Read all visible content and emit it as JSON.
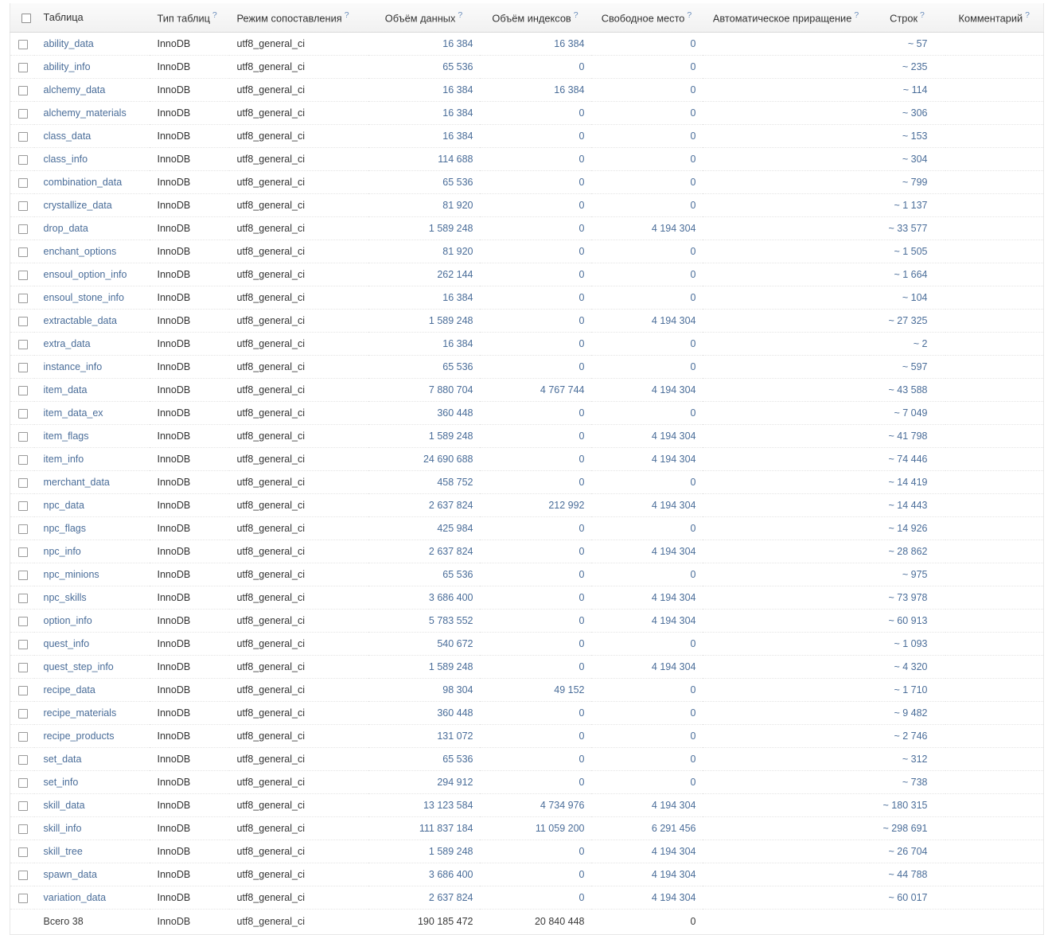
{
  "table": {
    "columns": [
      {
        "key": "check",
        "label": "",
        "help": false
      },
      {
        "key": "name",
        "label": "Таблица",
        "help": false
      },
      {
        "key": "type",
        "label": "Тип таблиц",
        "help": true
      },
      {
        "key": "coll",
        "label": "Режим сопоставления",
        "help": true
      },
      {
        "key": "data",
        "label": "Объём данных",
        "help": true
      },
      {
        "key": "index",
        "label": "Объём индексов",
        "help": true
      },
      {
        "key": "free",
        "label": "Свободное место",
        "help": true
      },
      {
        "key": "auto",
        "label": "Автоматическое приращение",
        "help": true
      },
      {
        "key": "rows",
        "label": "Строк",
        "help": true
      },
      {
        "key": "comment",
        "label": "Комментарий",
        "help": true
      }
    ],
    "help_glyph": "?",
    "rows": [
      {
        "name": "ability_data",
        "type": "InnoDB",
        "coll": "utf8_general_ci",
        "data": "16 384",
        "index": "16 384",
        "free": "0",
        "auto": "",
        "rows": "~ 57",
        "comment": ""
      },
      {
        "name": "ability_info",
        "type": "InnoDB",
        "coll": "utf8_general_ci",
        "data": "65 536",
        "index": "0",
        "free": "0",
        "auto": "",
        "rows": "~ 235",
        "comment": ""
      },
      {
        "name": "alchemy_data",
        "type": "InnoDB",
        "coll": "utf8_general_ci",
        "data": "16 384",
        "index": "16 384",
        "free": "0",
        "auto": "",
        "rows": "~ 114",
        "comment": ""
      },
      {
        "name": "alchemy_materials",
        "type": "InnoDB",
        "coll": "utf8_general_ci",
        "data": "16 384",
        "index": "0",
        "free": "0",
        "auto": "",
        "rows": "~ 306",
        "comment": ""
      },
      {
        "name": "class_data",
        "type": "InnoDB",
        "coll": "utf8_general_ci",
        "data": "16 384",
        "index": "0",
        "free": "0",
        "auto": "",
        "rows": "~ 153",
        "comment": ""
      },
      {
        "name": "class_info",
        "type": "InnoDB",
        "coll": "utf8_general_ci",
        "data": "114 688",
        "index": "0",
        "free": "0",
        "auto": "",
        "rows": "~ 304",
        "comment": ""
      },
      {
        "name": "combination_data",
        "type": "InnoDB",
        "coll": "utf8_general_ci",
        "data": "65 536",
        "index": "0",
        "free": "0",
        "auto": "",
        "rows": "~ 799",
        "comment": ""
      },
      {
        "name": "crystallize_data",
        "type": "InnoDB",
        "coll": "utf8_general_ci",
        "data": "81 920",
        "index": "0",
        "free": "0",
        "auto": "",
        "rows": "~ 1 137",
        "comment": ""
      },
      {
        "name": "drop_data",
        "type": "InnoDB",
        "coll": "utf8_general_ci",
        "data": "1 589 248",
        "index": "0",
        "free": "4 194 304",
        "auto": "",
        "rows": "~ 33 577",
        "comment": ""
      },
      {
        "name": "enchant_options",
        "type": "InnoDB",
        "coll": "utf8_general_ci",
        "data": "81 920",
        "index": "0",
        "free": "0",
        "auto": "",
        "rows": "~ 1 505",
        "comment": ""
      },
      {
        "name": "ensoul_option_info",
        "type": "InnoDB",
        "coll": "utf8_general_ci",
        "data": "262 144",
        "index": "0",
        "free": "0",
        "auto": "",
        "rows": "~ 1 664",
        "comment": ""
      },
      {
        "name": "ensoul_stone_info",
        "type": "InnoDB",
        "coll": "utf8_general_ci",
        "data": "16 384",
        "index": "0",
        "free": "0",
        "auto": "",
        "rows": "~ 104",
        "comment": ""
      },
      {
        "name": "extractable_data",
        "type": "InnoDB",
        "coll": "utf8_general_ci",
        "data": "1 589 248",
        "index": "0",
        "free": "4 194 304",
        "auto": "",
        "rows": "~ 27 325",
        "comment": ""
      },
      {
        "name": "extra_data",
        "type": "InnoDB",
        "coll": "utf8_general_ci",
        "data": "16 384",
        "index": "0",
        "free": "0",
        "auto": "",
        "rows": "~ 2",
        "comment": ""
      },
      {
        "name": "instance_info",
        "type": "InnoDB",
        "coll": "utf8_general_ci",
        "data": "65 536",
        "index": "0",
        "free": "0",
        "auto": "",
        "rows": "~ 597",
        "comment": ""
      },
      {
        "name": "item_data",
        "type": "InnoDB",
        "coll": "utf8_general_ci",
        "data": "7 880 704",
        "index": "4 767 744",
        "free": "4 194 304",
        "auto": "",
        "rows": "~ 43 588",
        "comment": ""
      },
      {
        "name": "item_data_ex",
        "type": "InnoDB",
        "coll": "utf8_general_ci",
        "data": "360 448",
        "index": "0",
        "free": "0",
        "auto": "",
        "rows": "~ 7 049",
        "comment": ""
      },
      {
        "name": "item_flags",
        "type": "InnoDB",
        "coll": "utf8_general_ci",
        "data": "1 589 248",
        "index": "0",
        "free": "4 194 304",
        "auto": "",
        "rows": "~ 41 798",
        "comment": ""
      },
      {
        "name": "item_info",
        "type": "InnoDB",
        "coll": "utf8_general_ci",
        "data": "24 690 688",
        "index": "0",
        "free": "4 194 304",
        "auto": "",
        "rows": "~ 74 446",
        "comment": ""
      },
      {
        "name": "merchant_data",
        "type": "InnoDB",
        "coll": "utf8_general_ci",
        "data": "458 752",
        "index": "0",
        "free": "0",
        "auto": "",
        "rows": "~ 14 419",
        "comment": ""
      },
      {
        "name": "npc_data",
        "type": "InnoDB",
        "coll": "utf8_general_ci",
        "data": "2 637 824",
        "index": "212 992",
        "free": "4 194 304",
        "auto": "",
        "rows": "~ 14 443",
        "comment": ""
      },
      {
        "name": "npc_flags",
        "type": "InnoDB",
        "coll": "utf8_general_ci",
        "data": "425 984",
        "index": "0",
        "free": "0",
        "auto": "",
        "rows": "~ 14 926",
        "comment": ""
      },
      {
        "name": "npc_info",
        "type": "InnoDB",
        "coll": "utf8_general_ci",
        "data": "2 637 824",
        "index": "0",
        "free": "4 194 304",
        "auto": "",
        "rows": "~ 28 862",
        "comment": ""
      },
      {
        "name": "npc_minions",
        "type": "InnoDB",
        "coll": "utf8_general_ci",
        "data": "65 536",
        "index": "0",
        "free": "0",
        "auto": "",
        "rows": "~ 975",
        "comment": ""
      },
      {
        "name": "npc_skills",
        "type": "InnoDB",
        "coll": "utf8_general_ci",
        "data": "3 686 400",
        "index": "0",
        "free": "4 194 304",
        "auto": "",
        "rows": "~ 73 978",
        "comment": ""
      },
      {
        "name": "option_info",
        "type": "InnoDB",
        "coll": "utf8_general_ci",
        "data": "5 783 552",
        "index": "0",
        "free": "4 194 304",
        "auto": "",
        "rows": "~ 60 913",
        "comment": ""
      },
      {
        "name": "quest_info",
        "type": "InnoDB",
        "coll": "utf8_general_ci",
        "data": "540 672",
        "index": "0",
        "free": "0",
        "auto": "",
        "rows": "~ 1 093",
        "comment": ""
      },
      {
        "name": "quest_step_info",
        "type": "InnoDB",
        "coll": "utf8_general_ci",
        "data": "1 589 248",
        "index": "0",
        "free": "4 194 304",
        "auto": "",
        "rows": "~ 4 320",
        "comment": ""
      },
      {
        "name": "recipe_data",
        "type": "InnoDB",
        "coll": "utf8_general_ci",
        "data": "98 304",
        "index": "49 152",
        "free": "0",
        "auto": "",
        "rows": "~ 1 710",
        "comment": ""
      },
      {
        "name": "recipe_materials",
        "type": "InnoDB",
        "coll": "utf8_general_ci",
        "data": "360 448",
        "index": "0",
        "free": "0",
        "auto": "",
        "rows": "~ 9 482",
        "comment": ""
      },
      {
        "name": "recipe_products",
        "type": "InnoDB",
        "coll": "utf8_general_ci",
        "data": "131 072",
        "index": "0",
        "free": "0",
        "auto": "",
        "rows": "~ 2 746",
        "comment": ""
      },
      {
        "name": "set_data",
        "type": "InnoDB",
        "coll": "utf8_general_ci",
        "data": "65 536",
        "index": "0",
        "free": "0",
        "auto": "",
        "rows": "~ 312",
        "comment": ""
      },
      {
        "name": "set_info",
        "type": "InnoDB",
        "coll": "utf8_general_ci",
        "data": "294 912",
        "index": "0",
        "free": "0",
        "auto": "",
        "rows": "~ 738",
        "comment": ""
      },
      {
        "name": "skill_data",
        "type": "InnoDB",
        "coll": "utf8_general_ci",
        "data": "13 123 584",
        "index": "4 734 976",
        "free": "4 194 304",
        "auto": "",
        "rows": "~ 180 315",
        "comment": ""
      },
      {
        "name": "skill_info",
        "type": "InnoDB",
        "coll": "utf8_general_ci",
        "data": "111 837 184",
        "index": "11 059 200",
        "free": "6 291 456",
        "auto": "",
        "rows": "~ 298 691",
        "comment": ""
      },
      {
        "name": "skill_tree",
        "type": "InnoDB",
        "coll": "utf8_general_ci",
        "data": "1 589 248",
        "index": "0",
        "free": "4 194 304",
        "auto": "",
        "rows": "~ 26 704",
        "comment": ""
      },
      {
        "name": "spawn_data",
        "type": "InnoDB",
        "coll": "utf8_general_ci",
        "data": "3 686 400",
        "index": "0",
        "free": "4 194 304",
        "auto": "",
        "rows": "~ 44 788",
        "comment": ""
      },
      {
        "name": "variation_data",
        "type": "InnoDB",
        "coll": "utf8_general_ci",
        "data": "2 637 824",
        "index": "0",
        "free": "4 194 304",
        "auto": "",
        "rows": "~ 60 017",
        "comment": ""
      }
    ],
    "total": {
      "name": "Всего 38",
      "type": "InnoDB",
      "coll": "utf8_general_ci",
      "data": "190 185 472",
      "index": "20 840 448",
      "free": "0",
      "auto": "",
      "rows": "",
      "comment": ""
    }
  },
  "colors": {
    "link": "#4a6d99",
    "header_bg": "#f4f4f4",
    "text": "#333333",
    "help": "#6a8dbb",
    "row_border": "#e4e4e4"
  }
}
